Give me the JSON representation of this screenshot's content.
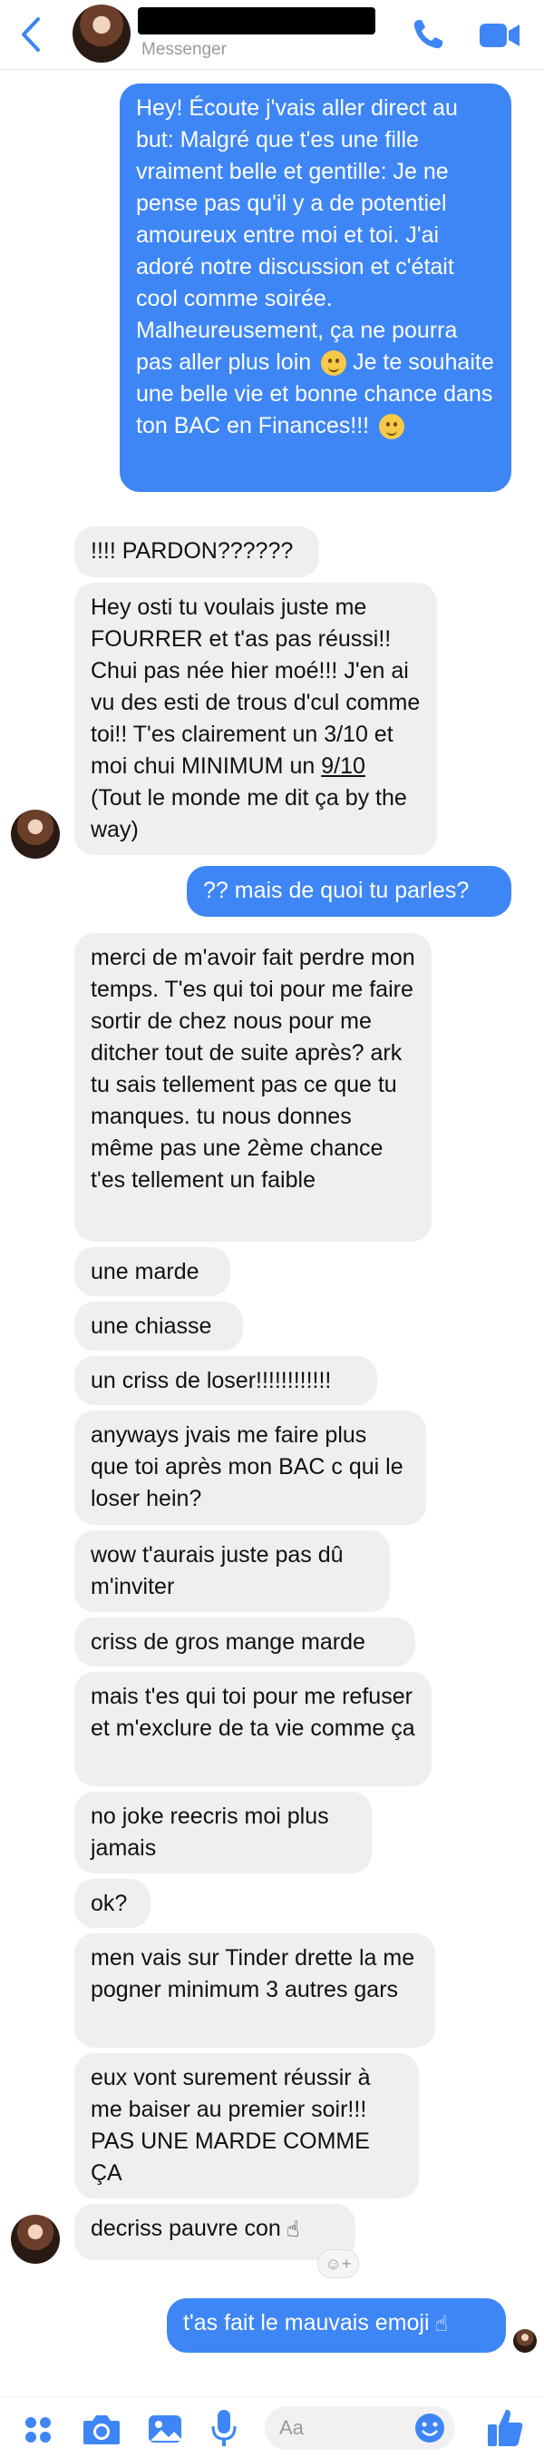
{
  "header": {
    "subtitle": "Messenger"
  },
  "messages": [
    {
      "dir": "out",
      "parts": [
        "Hey! Écoute j'vais aller direct au but: Malgré que t'es une fille vraiment belle et gentille: Je ne pense pas qu'il y a de potentiel amoureux entre moi et toi. J'ai adoré notre discussion et c'était cool comme soirée. Malheureusement, ça ne pourra pas aller plus loin",
        "Je te souhaite une belle vie et bonne chance dans ton BAC en Finances!!!"
      ]
    },
    {
      "dir": "in",
      "text": "!!!! PARDON??????"
    },
    {
      "dir": "in",
      "parts": [
        "Hey osti tu voulais juste me FOURRER et t'as pas réussi!! Chui pas née hier moé!!! J'en ai vu des esti de trous d'cul comme toi!! T'es clairement un 3/10 et moi chui MINIMUM un ",
        "9/10",
        " (Tout le monde me dit ça by the way)"
      ]
    },
    {
      "dir": "out",
      "text": "?? mais de quoi tu parles?"
    },
    {
      "dir": "in",
      "text": "merci de m'avoir fait perdre mon temps. T'es qui toi pour me faire sortir de chez nous pour me ditcher tout de suite après? ark tu sais tellement pas ce que tu manques. tu nous donnes même pas une 2ème chance t'es tellement un faible"
    },
    {
      "dir": "in",
      "text": "une marde"
    },
    {
      "dir": "in",
      "text": "une chiasse"
    },
    {
      "dir": "in",
      "text": "un criss de loser!!!!!!!!!!!!"
    },
    {
      "dir": "in",
      "text": "anyways jvais me faire plus que toi après mon BAC c qui le loser hein?"
    },
    {
      "dir": "in",
      "text": "wow t'aurais juste pas dû m'inviter"
    },
    {
      "dir": "in",
      "text": "criss de gros mange marde"
    },
    {
      "dir": "in",
      "text": "mais t'es qui toi pour me refuser et m'exclure de ta vie comme ça"
    },
    {
      "dir": "in",
      "text": "no joke reecris moi plus jamais"
    },
    {
      "dir": "in",
      "text": "ok?"
    },
    {
      "dir": "in",
      "text": "men vais sur Tinder drette la me pogner minimum 3 autres gars"
    },
    {
      "dir": "in",
      "text": "eux vont surement réussir à me baiser au premier soir!!! PAS UNE MARDE COMME ÇA"
    },
    {
      "dir": "in",
      "text": "decriss pauvre con"
    },
    {
      "dir": "out",
      "text": "t'as fait le mauvais emoji"
    }
  ],
  "composer": {
    "placeholder": "Aa"
  },
  "colors": {
    "accent": "#3e86f5",
    "incoming_bubble": "#efefef"
  },
  "icons": [
    "back-icon",
    "phone-icon",
    "video-icon",
    "apps-icon",
    "camera-icon",
    "gallery-icon",
    "mic-icon",
    "emoji-icon",
    "like-icon",
    "smile-emoji",
    "middle-finger-emoji",
    "pointing-up-emoji",
    "add-reaction-icon"
  ]
}
